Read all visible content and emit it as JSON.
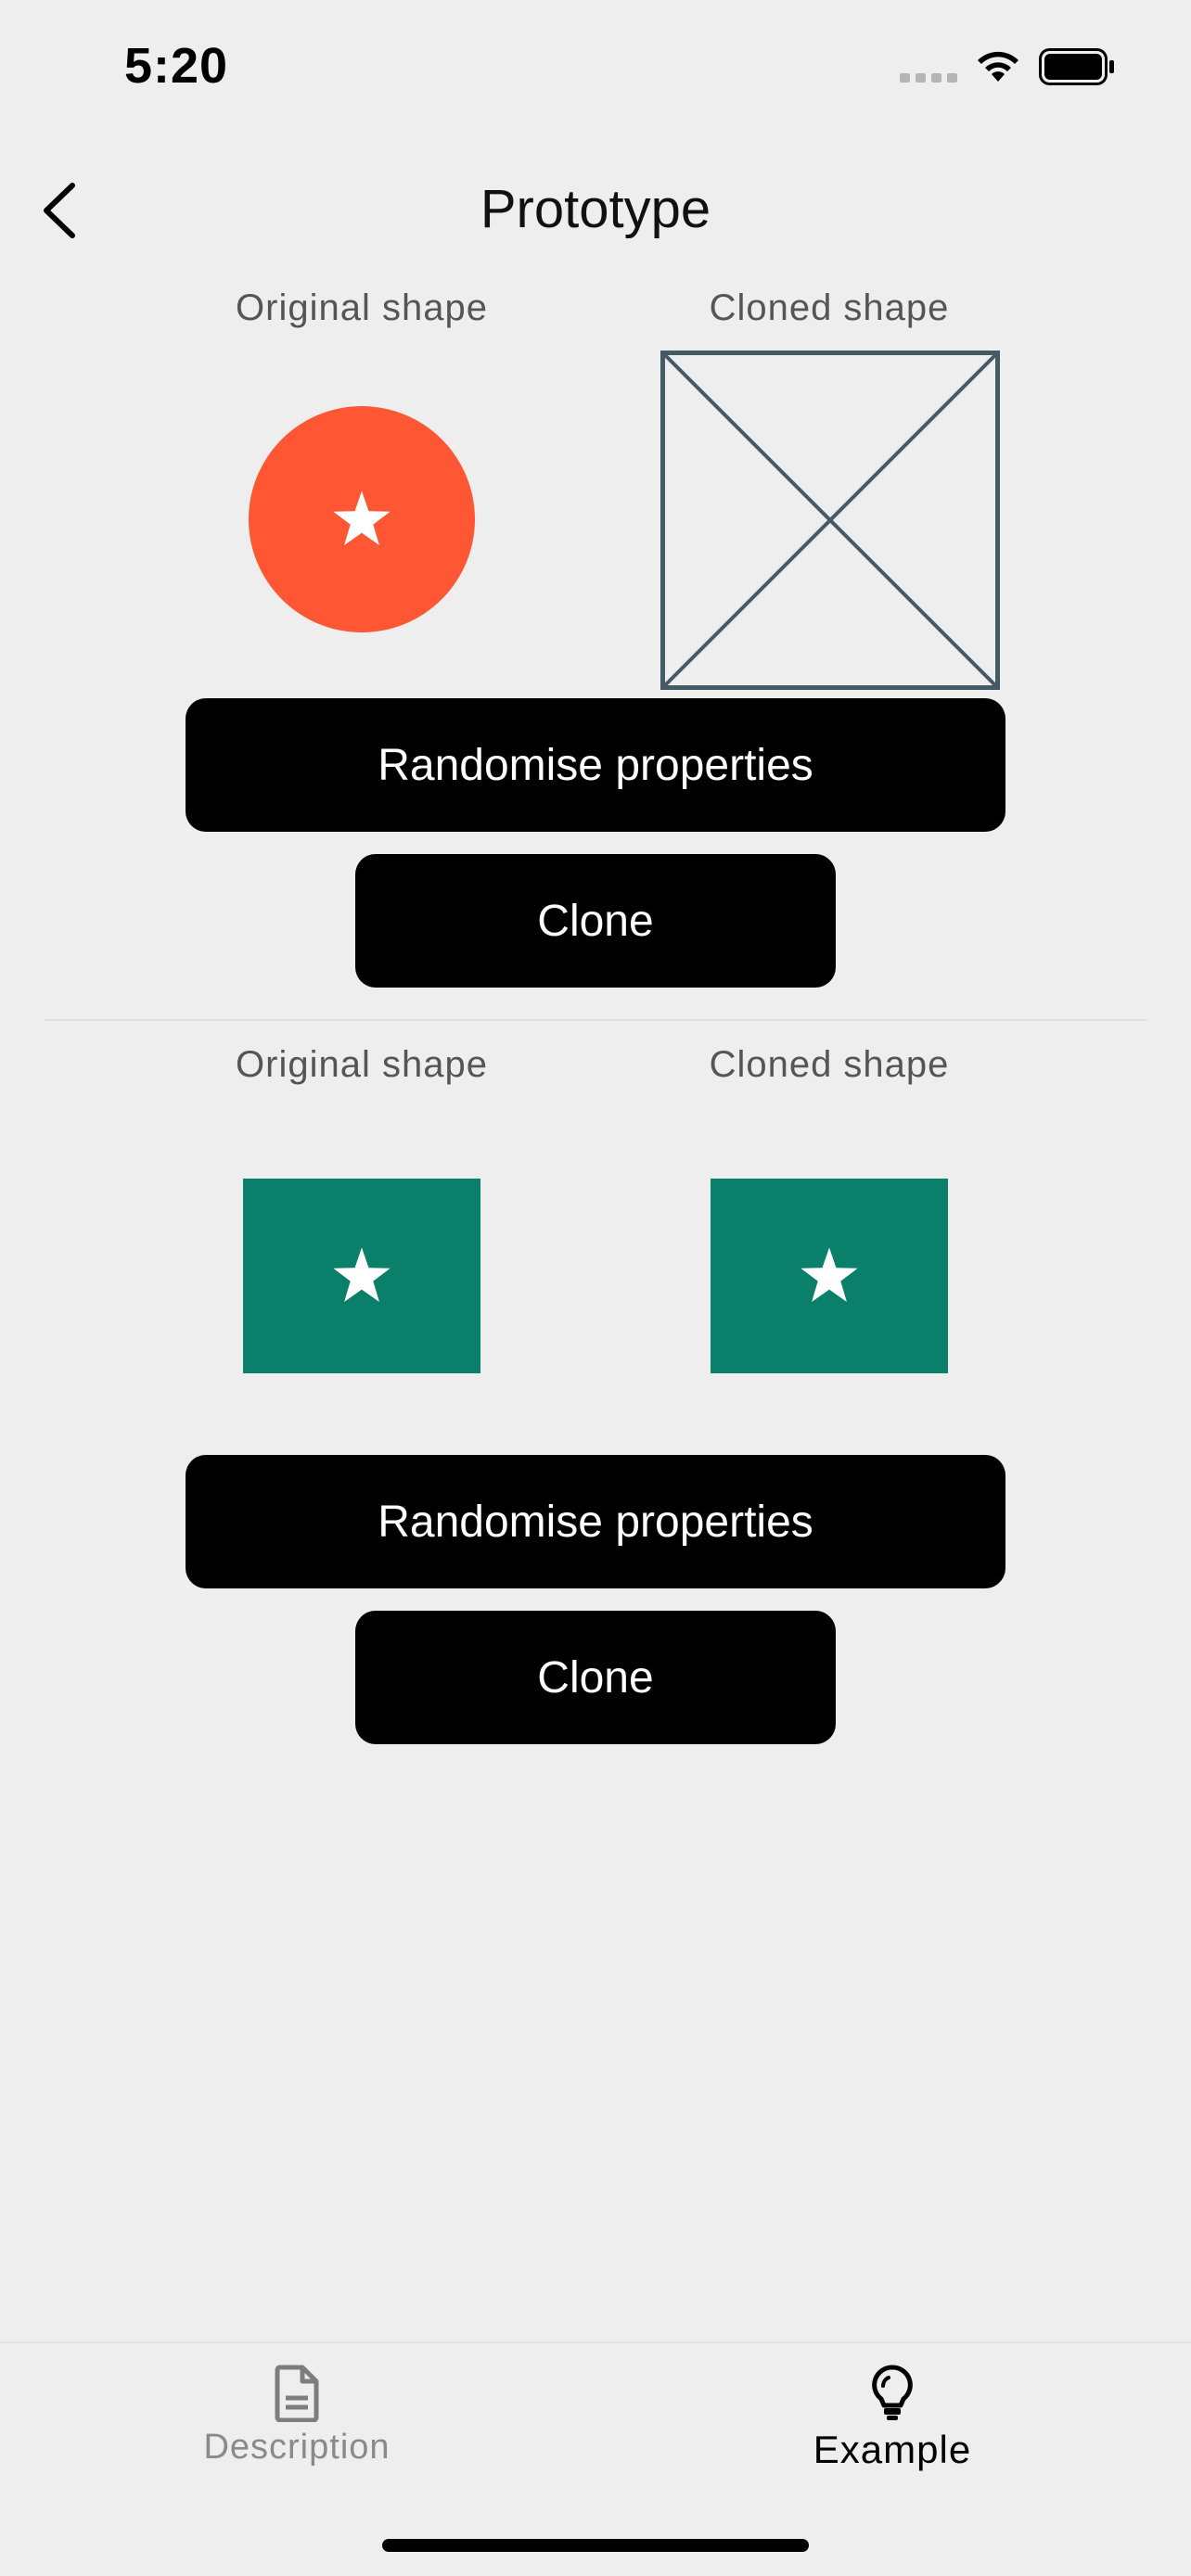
{
  "status_bar": {
    "time": "5:20"
  },
  "nav": {
    "title": "Prototype"
  },
  "section1": {
    "original_label": "Original shape",
    "cloned_label": "Cloned shape",
    "original_color": "#ff5733",
    "randomise_label": "Randomise properties",
    "clone_label": "Clone"
  },
  "section2": {
    "original_label": "Original shape",
    "cloned_label": "Cloned shape",
    "shape_color": "#0a806b",
    "randomise_label": "Randomise properties",
    "clone_label": "Clone"
  },
  "tabs": [
    {
      "label": "Description",
      "icon": "document-icon",
      "active": false
    },
    {
      "label": "Example",
      "icon": "lightbulb-icon",
      "active": true
    }
  ]
}
